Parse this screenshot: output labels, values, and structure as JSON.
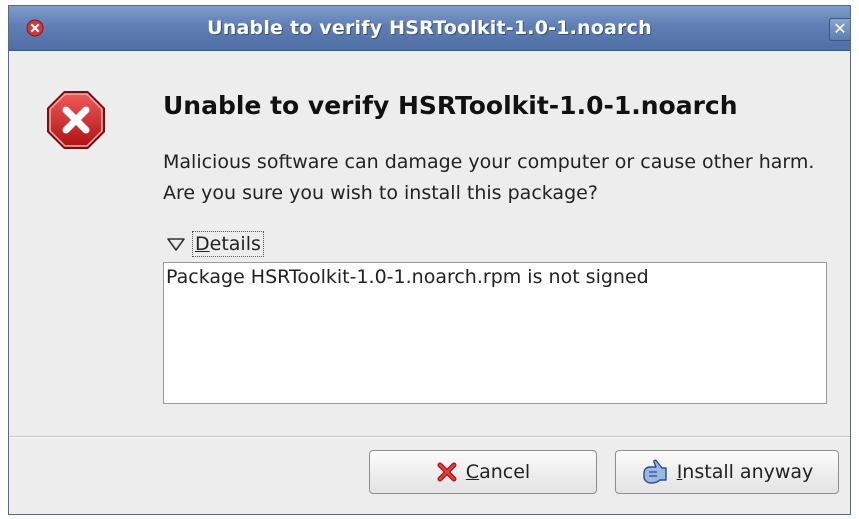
{
  "window": {
    "title": "Unable to verify HSRToolkit-1.0-1.noarch",
    "close_glyph": "✕"
  },
  "dialog": {
    "heading": "Unable to verify HSRToolkit-1.0-1.noarch",
    "message": "Malicious software can damage your computer or cause other harm.  Are you sure you wish to install this package?",
    "icon": "error-stop-icon"
  },
  "details": {
    "label_mnemonic": "D",
    "label_rest": "etails",
    "expanded": true,
    "text": "Package HSRToolkit-1.0-1.noarch.rpm is not signed"
  },
  "buttons": {
    "cancel": {
      "mnemonic": "C",
      "rest": "ancel",
      "icon": "cancel-x-icon"
    },
    "install": {
      "mnemonic": "I",
      "rest": "nstall anyway",
      "icon": "install-hand-icon"
    }
  },
  "colors": {
    "titlebar": "#5f7fb4",
    "error_red": "#c81e1e",
    "dialog_bg": "#ededed"
  }
}
